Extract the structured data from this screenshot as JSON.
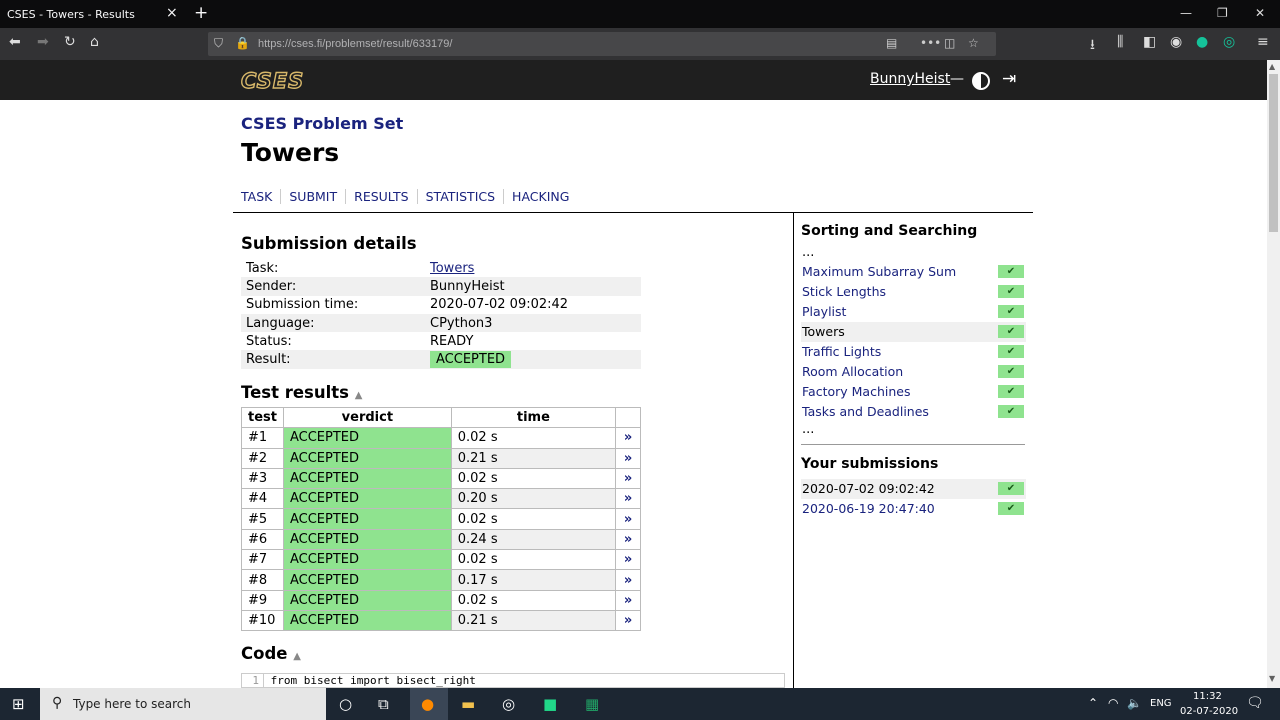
{
  "browser": {
    "tab_title": "CSES - Towers - Results",
    "url": "https://cses.fi/problemset/result/633179/"
  },
  "site": {
    "logo": "CSES",
    "username": "BunnyHeist",
    "dash": "—"
  },
  "page": {
    "set_title": "CSES Problem Set",
    "title": "Towers",
    "nav": [
      "TASK",
      "SUBMIT",
      "RESULTS",
      "STATISTICS",
      "HACKING"
    ]
  },
  "details": {
    "heading": "Submission details",
    "rows": [
      {
        "key": "Task:",
        "value": "Towers"
      },
      {
        "key": "Sender:",
        "value": "BunnyHeist"
      },
      {
        "key": "Submission time:",
        "value": "2020-07-02 09:02:42"
      },
      {
        "key": "Language:",
        "value": "CPython3"
      },
      {
        "key": "Status:",
        "value": "READY"
      },
      {
        "key": "Result:",
        "value": "ACCEPTED"
      }
    ]
  },
  "tests": {
    "heading": "Test results",
    "headers": [
      "test",
      "verdict",
      "time"
    ],
    "rows": [
      {
        "test": "#1",
        "verdict": "ACCEPTED",
        "time": "0.02 s"
      },
      {
        "test": "#2",
        "verdict": "ACCEPTED",
        "time": "0.21 s"
      },
      {
        "test": "#3",
        "verdict": "ACCEPTED",
        "time": "0.02 s"
      },
      {
        "test": "#4",
        "verdict": "ACCEPTED",
        "time": "0.20 s"
      },
      {
        "test": "#5",
        "verdict": "ACCEPTED",
        "time": "0.02 s"
      },
      {
        "test": "#6",
        "verdict": "ACCEPTED",
        "time": "0.24 s"
      },
      {
        "test": "#7",
        "verdict": "ACCEPTED",
        "time": "0.02 s"
      },
      {
        "test": "#8",
        "verdict": "ACCEPTED",
        "time": "0.17 s"
      },
      {
        "test": "#9",
        "verdict": "ACCEPTED",
        "time": "0.02 s"
      },
      {
        "test": "#10",
        "verdict": "ACCEPTED",
        "time": "0.21 s"
      }
    ],
    "link_glyph": "»"
  },
  "code": {
    "heading": "Code",
    "line_no": "1",
    "first_line": "from bisect import bisect_right"
  },
  "sidebar": {
    "section_title": "Sorting and Searching",
    "ellipsis": "...",
    "items": [
      {
        "label": "Maximum Subarray Sum",
        "current": false
      },
      {
        "label": "Stick Lengths",
        "current": false
      },
      {
        "label": "Playlist",
        "current": false
      },
      {
        "label": "Towers",
        "current": true
      },
      {
        "label": "Traffic Lights",
        "current": false
      },
      {
        "label": "Room Allocation",
        "current": false
      },
      {
        "label": "Factory Machines",
        "current": false
      },
      {
        "label": "Tasks and Deadlines",
        "current": false
      }
    ],
    "submissions_title": "Your submissions",
    "submissions": [
      {
        "label": "2020-07-02 09:02:42",
        "current": true
      },
      {
        "label": "2020-06-19 20:47:40",
        "current": false
      }
    ],
    "check_glyph": "✔"
  },
  "taskbar": {
    "search_placeholder": "Type here to search",
    "lang": "ENG",
    "time": "11:32",
    "date": "02-07-2020"
  },
  "colors": {
    "accent_link": "#1a237e",
    "accepted_green": "#8fe38f",
    "header_bg": "#1f1f1f"
  }
}
